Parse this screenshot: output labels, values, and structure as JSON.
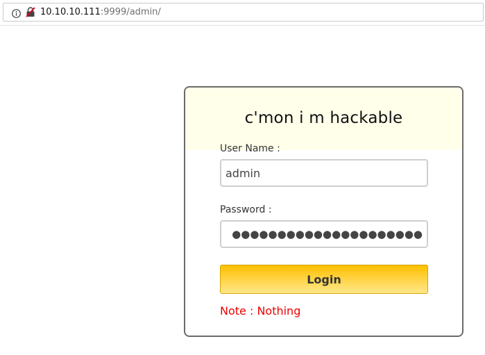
{
  "browser": {
    "url_host": "10.10.10.111",
    "url_rest": ":9999/admin/",
    "info_icon": "info-circle",
    "insecure_icon": "insecure-lock-crossed",
    "accent_color": "#d70022"
  },
  "login": {
    "title": "c'mon i m hackable",
    "username_label": "User Name :",
    "username_value": "admin",
    "password_label": "Password :",
    "password_mask": "●●●●●●●●●●●●●●●●●●●●●",
    "login_button": "Login",
    "note": "Note : Nothing",
    "header_color": "#ffffea",
    "button_color": "#ffc000",
    "note_color": "#ee0000"
  }
}
